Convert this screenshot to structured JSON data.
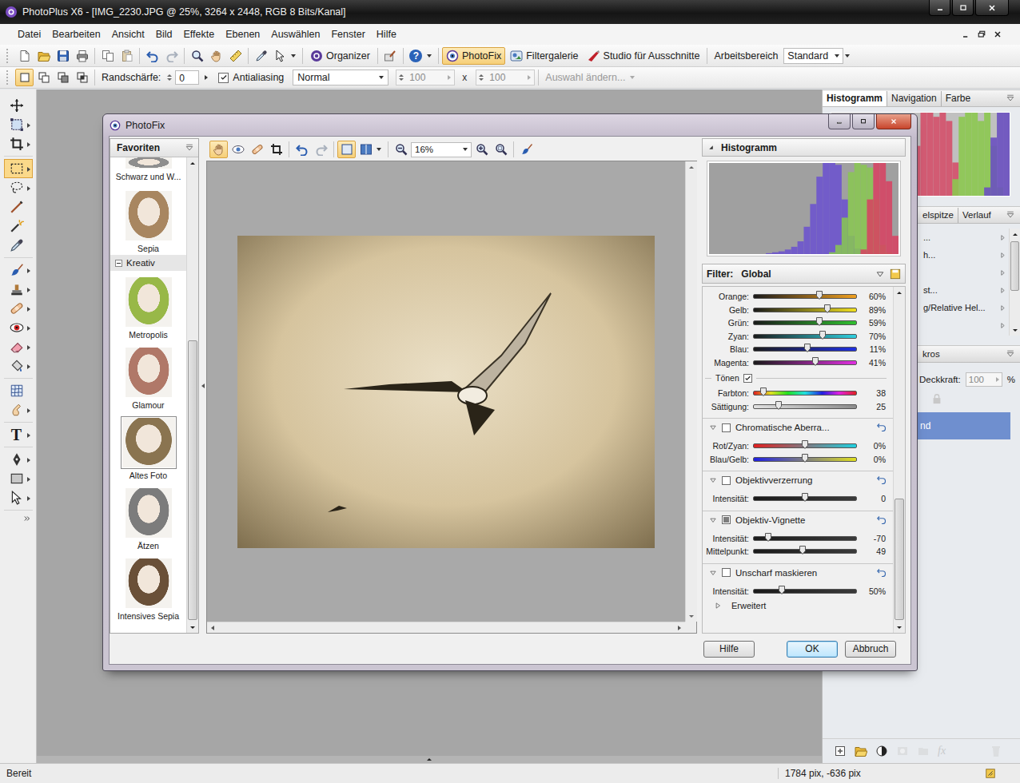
{
  "app_window": {
    "title": "PhotoPlus X6 - [IMG_2230.JPG @ 25%, 3264 x 2448, RGB 8 Bits/Kanal]"
  },
  "menu": [
    "Datei",
    "Bearbeiten",
    "Ansicht",
    "Bild",
    "Effekte",
    "Ebenen",
    "Auswählen",
    "Fenster",
    "Hilfe"
  ],
  "toolbar": {
    "organizer": "Organizer",
    "help_glyph": "?",
    "buttons": [
      {
        "label": "PhotoFix",
        "kind": "photofix",
        "selected": true
      },
      {
        "label": "Filtergalerie",
        "kind": "filter",
        "selected": false
      },
      {
        "label": "Studio für Ausschnitte",
        "kind": "cutout",
        "selected": false
      }
    ],
    "workspace": {
      "label": "Arbeitsbereich",
      "value": "Standard"
    }
  },
  "context_bar": {
    "modes": [
      {
        "selected": true
      },
      {
        "selected": false
      },
      {
        "selected": false
      },
      {
        "selected": false
      }
    ],
    "feather": {
      "label": "Randschärfe:",
      "value": "0"
    },
    "antialias": {
      "label": "Antialiasing",
      "checked": true
    },
    "blend_mode": "Normal",
    "size": {
      "width": "100",
      "separator": "x",
      "height": "100",
      "disabled": true
    },
    "modify": {
      "label": "Auswahl ändern...",
      "disabled": true
    }
  },
  "tool_groups": [
    [
      {
        "kind": "move",
        "selected": false,
        "flyout": false
      },
      {
        "kind": "deform",
        "selected": false,
        "flyout": true
      },
      {
        "kind": "crop",
        "selected": false,
        "flyout": true
      }
    ],
    [
      {
        "kind": "rect",
        "selected": true,
        "flyout": true
      },
      {
        "kind": "lasso",
        "selected": false,
        "flyout": true
      },
      {
        "kind": "line",
        "selected": false,
        "flyout": false
      },
      {
        "kind": "wand",
        "selected": false,
        "flyout": false
      },
      {
        "kind": "dropper",
        "selected": false,
        "flyout": false
      }
    ],
    [
      {
        "kind": "brush",
        "selected": false,
        "flyout": true
      },
      {
        "kind": "clone",
        "selected": false,
        "flyout": true
      },
      {
        "kind": "bandage",
        "selected": false,
        "flyout": true
      },
      {
        "kind": "redeye",
        "selected": false,
        "flyout": true
      },
      {
        "kind": "eraser",
        "selected": false,
        "flyout": true
      },
      {
        "kind": "fill",
        "selected": false,
        "flyout": true
      }
    ],
    [
      {
        "kind": "mesh",
        "selected": false,
        "flyout": false
      },
      {
        "kind": "smudge",
        "selected": false,
        "flyout": true
      }
    ],
    [
      {
        "kind": "text",
        "glyph": "T",
        "selected": false,
        "flyout": true
      }
    ],
    [
      {
        "kind": "pen",
        "selected": false,
        "flyout": true
      },
      {
        "kind": "shape",
        "selected": false,
        "flyout": true
      },
      {
        "kind": "node",
        "selected": false,
        "flyout": true
      }
    ]
  ],
  "panels": {
    "top_tabs": [
      {
        "label": "Histogramm",
        "selected": true
      },
      {
        "label": "Navigation",
        "selected": false
      },
      {
        "label": "Farbe",
        "selected": false
      }
    ],
    "histogram_series": [
      {
        "color": "#d4506a",
        "values": [
          0,
          0,
          0,
          0,
          0,
          0,
          0,
          0,
          0,
          0,
          0,
          0,
          0,
          60,
          100,
          100,
          95,
          100,
          90,
          40,
          0,
          0,
          0,
          0,
          0,
          0,
          0,
          0
        ]
      },
      {
        "color": "#8cc850",
        "values": [
          0,
          0,
          0,
          0,
          0,
          0,
          0,
          0,
          0,
          0,
          0,
          0,
          0,
          0,
          0,
          0,
          0,
          0,
          0,
          20,
          95,
          100,
          100,
          90,
          100,
          60,
          10,
          0
        ]
      },
      {
        "color": "#6a50c0",
        "values": [
          0,
          0,
          0,
          0,
          0,
          0,
          0,
          0,
          0,
          0,
          0,
          0,
          0,
          0,
          0,
          0,
          0,
          0,
          0,
          0,
          0,
          0,
          0,
          0,
          10,
          70,
          100,
          100
        ]
      }
    ],
    "brush_tabs": [
      {
        "label": "elspitze",
        "selected": false
      },
      {
        "label": "Verlauf",
        "selected": false
      }
    ],
    "brush_rows": [
      {
        "label": "..."
      },
      {
        "label": "h..."
      },
      {
        "label": ""
      },
      {
        "label": "st..."
      },
      {
        "label": "g/Relative Hel..."
      },
      {
        "label": ""
      }
    ],
    "layers": {
      "tab": "kros",
      "opacity_label": "Deckkraft:",
      "opacity_value": "100",
      "opacity_unit": "%"
    },
    "layer_row": {
      "label": "nd",
      "selected": true
    },
    "layer_actions": [
      {
        "kind": "newlayer",
        "disabled": false
      },
      {
        "kind": "folder",
        "disabled": false
      },
      {
        "kind": "adjust",
        "disabled": false
      },
      {
        "kind": "mask",
        "disabled": true
      },
      {
        "kind": "group",
        "disabled": true
      },
      {
        "kind": "fx",
        "label": "fx",
        "disabled": true
      },
      {
        "kind": "delete",
        "disabled": true
      }
    ]
  },
  "status_bar": {
    "left": "Bereit",
    "coords": "1784 pix, -636 pix"
  },
  "photofix": {
    "title": "PhotoFix",
    "favorites": {
      "title": "Favoriten",
      "items": [
        {
          "kind": "thumb",
          "label": "Schwarz und W...",
          "color": "#8e8e8e",
          "selected": false
        },
        {
          "kind": "thumb",
          "label": "Sepia",
          "color": "#a88660",
          "selected": false
        },
        {
          "kind": "group",
          "label": "Kreativ",
          "expanded": true
        },
        {
          "kind": "thumb",
          "label": "Metropolis",
          "color": "#98b848",
          "selected": false
        },
        {
          "kind": "thumb",
          "label": "Glamour",
          "color": "#b07868",
          "selected": false
        },
        {
          "kind": "thumb",
          "label": "Altes Foto",
          "color": "#8a7450",
          "selected": true
        },
        {
          "kind": "thumb",
          "label": "Ätzen",
          "color": "#7c7c7c",
          "selected": false
        },
        {
          "kind": "thumb",
          "label": "Intensives Sepia",
          "color": "#6a5038",
          "selected": false
        }
      ]
    },
    "preview_tools": [
      {
        "kind": "hand",
        "selected": true
      },
      {
        "kind": "eye",
        "selected": false
      },
      {
        "kind": "bandage",
        "selected": false
      },
      {
        "kind": "crop",
        "selected": false
      },
      {
        "kind": "undo",
        "selected": false
      },
      {
        "kind": "redo",
        "selected": false
      },
      {
        "kind": "single",
        "selected": true
      },
      {
        "kind": "split",
        "selected": false
      }
    ],
    "zoom": "16%",
    "histogram": {
      "title": "Histogramm",
      "expanded": true,
      "series": [
        {
          "color": "#6a50d0",
          "values": [
            0,
            0,
            0,
            0,
            0,
            0,
            0,
            0,
            0,
            1,
            2,
            3,
            5,
            8,
            14,
            30,
            55,
            85,
            100,
            100,
            98,
            60,
            20,
            6,
            3,
            2,
            1,
            0,
            0,
            0
          ]
        },
        {
          "color": "#88c850",
          "values": [
            0,
            0,
            0,
            0,
            0,
            0,
            0,
            0,
            0,
            0,
            0,
            0,
            0,
            0,
            0,
            0,
            0,
            0,
            0,
            2,
            10,
            40,
            90,
            100,
            98,
            95,
            60,
            10,
            2,
            0
          ]
        },
        {
          "color": "#d84060",
          "values": [
            0,
            0,
            0,
            0,
            0,
            0,
            0,
            0,
            0,
            0,
            0,
            0,
            0,
            0,
            0,
            0,
            0,
            0,
            0,
            0,
            0,
            0,
            0,
            0,
            5,
            60,
            100,
            100,
            80,
            20
          ]
        }
      ]
    },
    "filter": {
      "label": "Filter:",
      "value": "Global"
    },
    "sections": [
      {
        "kind": "global",
        "rows": [
          {
            "kind": "slider",
            "label": "Orange:",
            "reading": "60%",
            "level": 0.64,
            "colors": [
              "#1a1a1a",
              "#f0a020"
            ]
          },
          {
            "kind": "slider",
            "label": "Gelb:",
            "reading": "89%",
            "level": 0.72,
            "colors": [
              "#1a1a1a",
              "#f0e020"
            ]
          },
          {
            "kind": "slider",
            "label": "Grün:",
            "reading": "59%",
            "level": 0.64,
            "colors": [
              "#1a1a1a",
              "#30c030"
            ]
          },
          {
            "kind": "slider",
            "label": "Zyan:",
            "reading": "70%",
            "level": 0.67,
            "colors": [
              "#1a1a1a",
              "#30d0e0"
            ]
          },
          {
            "kind": "slider",
            "label": "Blau:",
            "reading": "11%",
            "level": 0.52,
            "colors": [
              "#1a1a1a",
              "#2030e0"
            ]
          },
          {
            "kind": "slider",
            "label": "Magenta:",
            "reading": "41%",
            "level": 0.6,
            "colors": [
              "#1a1a1a",
              "#e030e0"
            ]
          },
          {
            "kind": "check",
            "label": "Tönen",
            "checked": true
          },
          {
            "kind": "slider",
            "label": "Farbton:",
            "reading": "38",
            "level": 0.09,
            "colors": [
              "#e02020",
              "#e0e020",
              "#20e020",
              "#20e0e0",
              "#2020e0",
              "#e020e0",
              "#e02020"
            ]
          },
          {
            "kind": "slider",
            "label": "Sättigung:",
            "reading": "25",
            "level": 0.24,
            "colors": [
              "#e0e0e0",
              "#8c8c8c"
            ]
          }
        ]
      },
      {
        "kind": "panel",
        "title": "Chromatische Aberra...",
        "checked": false,
        "expanded": true,
        "rows": [
          {
            "kind": "slider",
            "label": "Rot/Zyan:",
            "reading": "0%",
            "level": 0.5,
            "colors": [
              "#e02020",
              "#20d0e0"
            ]
          },
          {
            "kind": "slider",
            "label": "Blau/Gelb:",
            "reading": "0%",
            "level": 0.5,
            "colors": [
              "#2020e0",
              "#e0e020"
            ]
          }
        ]
      },
      {
        "kind": "panel",
        "title": "Objektivverzerrung",
        "checked": false,
        "expanded": true,
        "rows": [
          {
            "kind": "slider",
            "label": "Intensität:",
            "reading": "0",
            "level": 0.5,
            "colors": [
              "#1a1a1a",
              "#3a3a3a"
            ]
          }
        ]
      },
      {
        "kind": "panel",
        "title": "Objektiv-Vignette",
        "checked": true,
        "expanded": true,
        "rows": [
          {
            "kind": "slider",
            "label": "Intensität:",
            "reading": "-70",
            "level": 0.14,
            "colors": [
              "#1a1a1a",
              "#3a3a3a"
            ]
          },
          {
            "kind": "slider",
            "label": "Mittelpunkt:",
            "reading": "49",
            "level": 0.48,
            "colors": [
              "#1a1a1a",
              "#3a3a3a"
            ]
          }
        ]
      },
      {
        "kind": "panel",
        "title": "Unscharf maskieren",
        "checked": false,
        "expanded": true,
        "rows": [
          {
            "kind": "slider",
            "label": "Intensität:",
            "reading": "50%",
            "level": 0.27,
            "colors": [
              "#1a1a1a",
              "#3a3a3a"
            ]
          },
          {
            "kind": "more",
            "label": "Erweitert",
            "expanded": false
          }
        ]
      }
    ],
    "buttons": [
      {
        "label": "Hilfe",
        "default": false
      },
      {
        "label": "OK",
        "default": true
      },
      {
        "label": "Abbruch",
        "default": false
      }
    ]
  }
}
